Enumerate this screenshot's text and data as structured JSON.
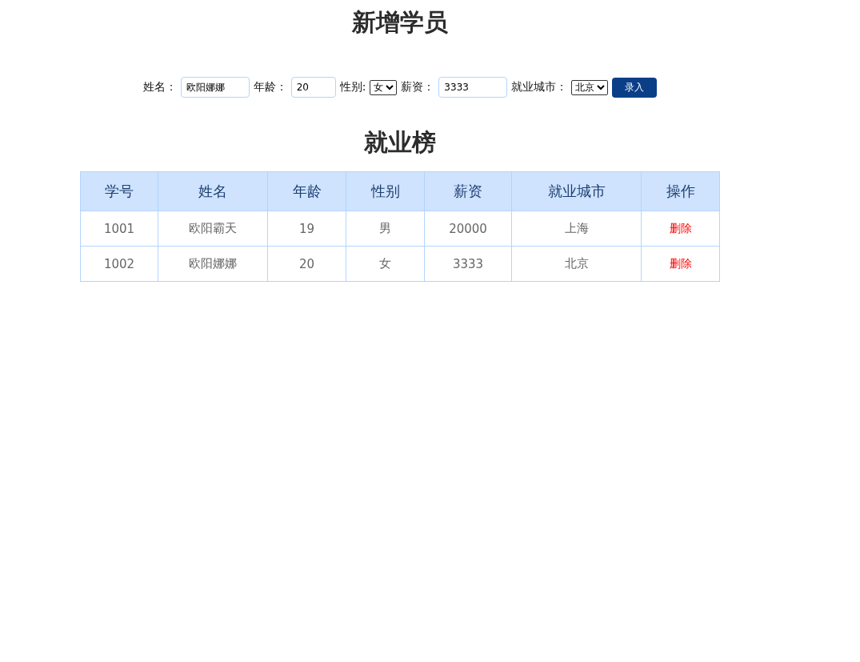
{
  "form_title": "新增学员",
  "form": {
    "fields": [
      {
        "kind": "input",
        "label": "姓名：",
        "value": "欧阳娜娜"
      },
      {
        "kind": "input",
        "label": "年龄：",
        "value": "20"
      },
      {
        "kind": "select",
        "label": "性别:",
        "value": "女"
      },
      {
        "kind": "input",
        "label": "薪资：",
        "value": "3333"
      },
      {
        "kind": "select",
        "label": "就业城市：",
        "value": "北京"
      }
    ],
    "submit": "录入"
  },
  "table_title": "就业榜",
  "table": {
    "columns": [
      "学号",
      "姓名",
      "年龄",
      "性别",
      "薪资",
      "就业城市",
      "操作"
    ],
    "rows": [
      {
        "cells": [
          "1001",
          "欧阳霸天",
          "19",
          "男",
          "20000",
          "上海"
        ],
        "action": "删除"
      },
      {
        "cells": [
          "1002",
          "欧阳娜娜",
          "20",
          "女",
          "3333",
          "北京"
        ],
        "action": "删除"
      }
    ]
  }
}
